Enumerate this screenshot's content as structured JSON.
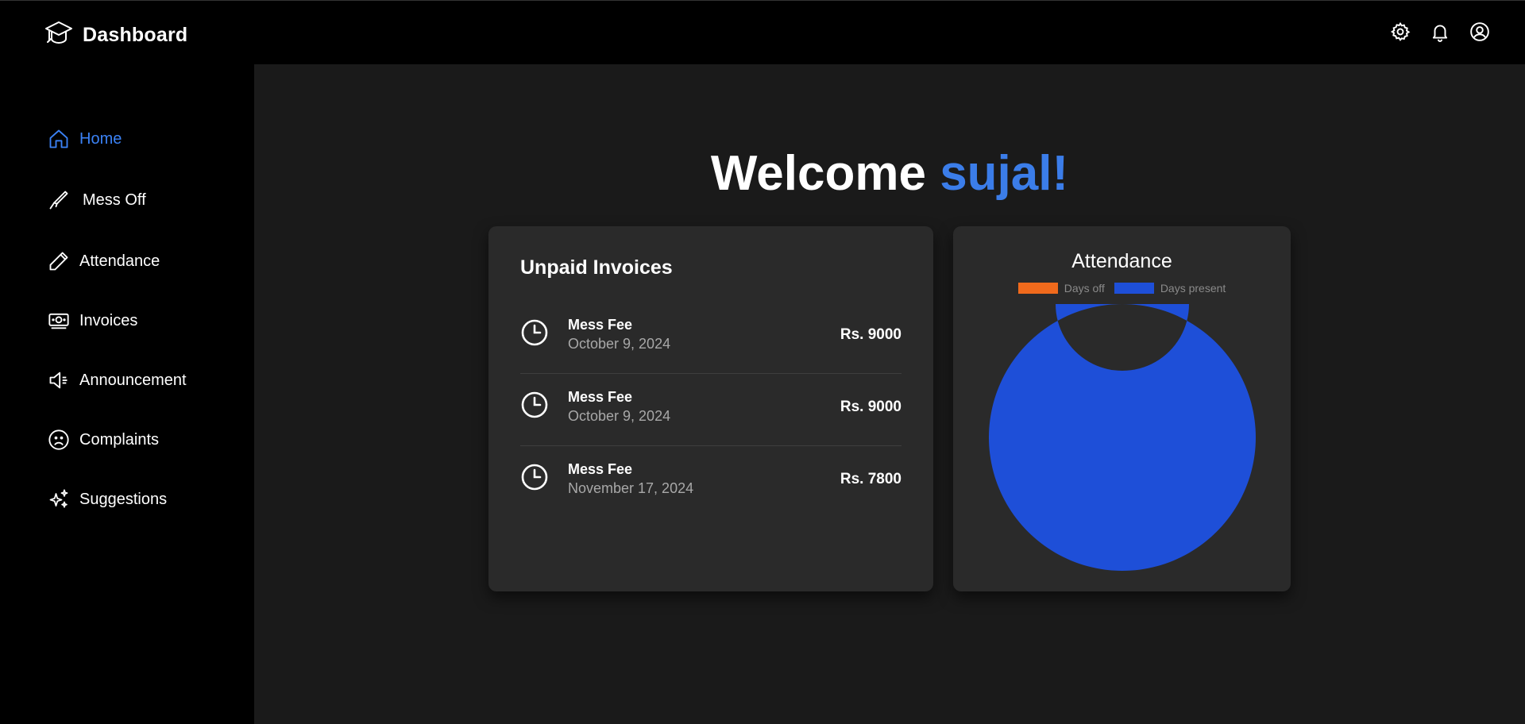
{
  "header": {
    "title": "Dashboard",
    "logo_icon": "graduation-cap-icon",
    "icons": [
      "gear-icon",
      "bell-icon",
      "user-circle-icon"
    ]
  },
  "sidebar": {
    "items": [
      {
        "label": "Home",
        "icon": "home-icon",
        "active": true
      },
      {
        "label": "Mess Off",
        "icon": "knife-icon",
        "active": false
      },
      {
        "label": "Attendance",
        "icon": "pencil-icon",
        "active": false
      },
      {
        "label": "Invoices",
        "icon": "money-icon",
        "active": false
      },
      {
        "label": "Announcement",
        "icon": "megaphone-icon",
        "active": false
      },
      {
        "label": "Complaints",
        "icon": "frown-icon",
        "active": false
      },
      {
        "label": "Suggestions",
        "icon": "sparkles-icon",
        "active": false
      }
    ]
  },
  "main": {
    "welcome_prefix": "Welcome",
    "welcome_name": "sujal!",
    "invoices": {
      "title": "Unpaid Invoices",
      "rows": [
        {
          "title": "Mess Fee",
          "date": "October 9, 2024",
          "amount": "Rs. 9000"
        },
        {
          "title": "Mess Fee",
          "date": "October 9, 2024",
          "amount": "Rs. 9000"
        },
        {
          "title": "Mess Fee",
          "date": "November 17, 2024",
          "amount": "Rs. 7800"
        }
      ]
    },
    "attendance": {
      "title": "Attendance"
    }
  },
  "colors": {
    "accent": "#3b7de9",
    "days_off": "#f06a1c",
    "days_present": "#1e4fd8"
  },
  "chart_data": {
    "type": "pie",
    "title": "Attendance",
    "categories": [
      "Days off",
      "Days present"
    ],
    "values": [
      0,
      1
    ],
    "colors": [
      "#f06a1c",
      "#1e4fd8"
    ],
    "legend": "top"
  }
}
